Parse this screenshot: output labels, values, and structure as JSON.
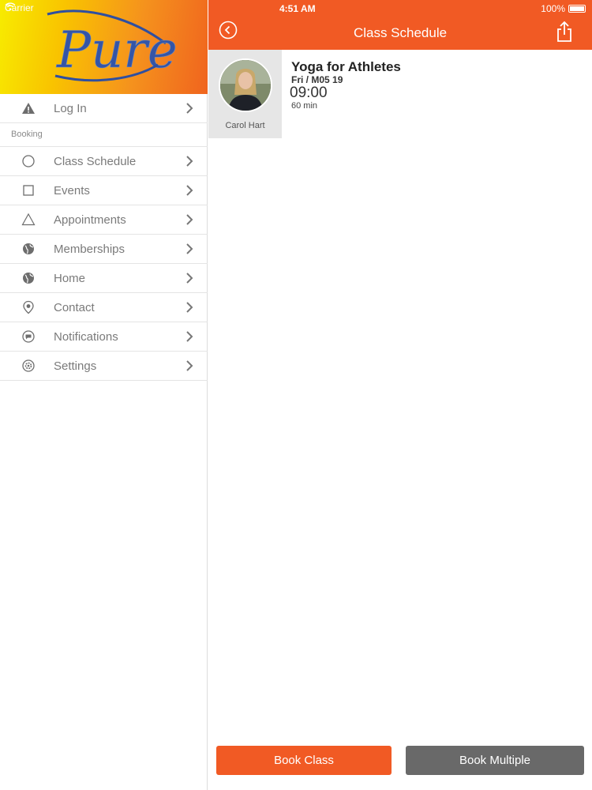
{
  "status_bar": {
    "carrier": "Carrier",
    "time": "4:51 AM",
    "battery": "100%"
  },
  "brand": {
    "logo_text": "Pure",
    "gradient_start": "#f7ec00",
    "gradient_end": "#f0641e",
    "logo_color": "#2f4fa0"
  },
  "sidebar": {
    "login": {
      "label": "Log In",
      "icon": "warning-icon"
    },
    "section_header": "Booking",
    "items": [
      {
        "label": "Class Schedule",
        "icon": "circle-icon"
      },
      {
        "label": "Events",
        "icon": "square-icon"
      },
      {
        "label": "Appointments",
        "icon": "triangle-icon"
      },
      {
        "label": "Memberships",
        "icon": "globe-icon"
      },
      {
        "label": "Home",
        "icon": "globe-icon"
      },
      {
        "label": "Contact",
        "icon": "location-pin-icon"
      },
      {
        "label": "Notifications",
        "icon": "chat-bubble-icon"
      },
      {
        "label": "Settings",
        "icon": "gear-icon"
      }
    ]
  },
  "header": {
    "title": "Class Schedule",
    "accent": "#f15a24"
  },
  "class_detail": {
    "instructor": "Carol Hart",
    "title": "Yoga for Athletes",
    "date": "Fri / M05 19",
    "time": "09:00",
    "duration": "60 min"
  },
  "actions": {
    "book_class": "Book Class",
    "book_multiple": "Book Multiple"
  }
}
